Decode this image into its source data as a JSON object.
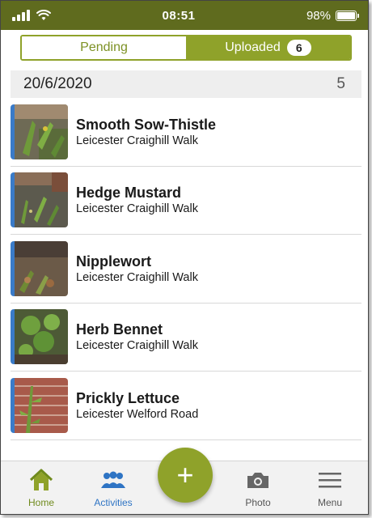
{
  "status_bar": {
    "time": "08:51",
    "battery_percent_label": "98%",
    "battery_level": 0.98
  },
  "tabs": {
    "pending_label": "Pending",
    "uploaded_label": "Uploaded",
    "uploaded_count": "6"
  },
  "date_group": {
    "date": "20/6/2020",
    "count": "5"
  },
  "records": [
    {
      "title": "Smooth Sow-Thistle",
      "location": "Leicester Craighill Walk"
    },
    {
      "title": "Hedge Mustard",
      "location": "Leicester Craighill Walk"
    },
    {
      "title": "Nipplewort",
      "location": "Leicester Craighill Walk"
    },
    {
      "title": "Herb Bennet",
      "location": "Leicester Craighill Walk"
    },
    {
      "title": "Prickly Lettuce",
      "location": "Leicester Welford Road"
    }
  ],
  "bottom_nav": {
    "home_label": "Home",
    "activities_label": "Activities",
    "add_label": "+",
    "photo_label": "Photo",
    "menu_label": "Menu",
    "icons": {
      "home": "home-icon",
      "activities": "people-icon",
      "photo": "camera-icon",
      "menu": "hamburger-icon"
    }
  },
  "colors": {
    "brand_green": "#8fa22a",
    "status_bar": "#5f6b1e",
    "accent_blue": "#3a7bc8"
  }
}
